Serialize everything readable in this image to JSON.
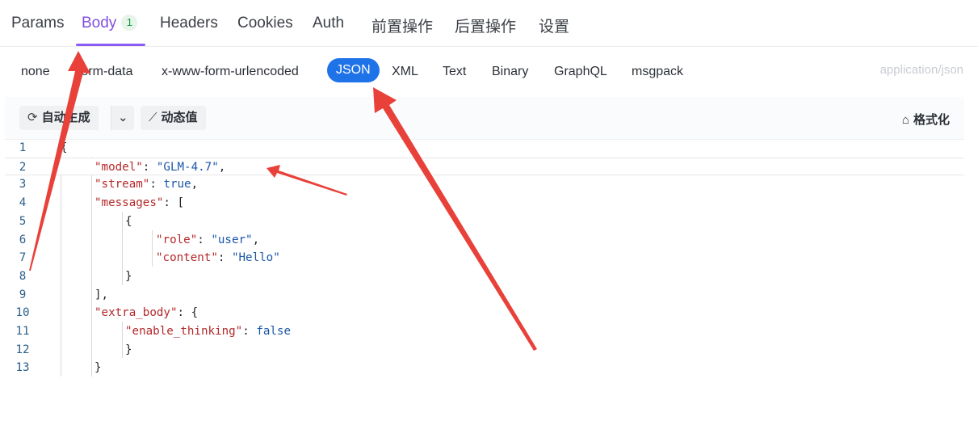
{
  "tabs": [
    {
      "label": "Params"
    },
    {
      "label": "Body",
      "badge": "1",
      "active": true
    },
    {
      "label": "Headers"
    },
    {
      "label": "Cookies"
    },
    {
      "label": "Auth"
    },
    {
      "label": "前置操作"
    },
    {
      "label": "后置操作"
    },
    {
      "label": "设置"
    }
  ],
  "body_types": [
    "none",
    "form-data",
    "x-www-form-urlencoded",
    "JSON",
    "XML",
    "Text",
    "Binary",
    "GraphQL",
    "msgpack"
  ],
  "active_body_type": "JSON",
  "content_type": "application/json",
  "toolbar": {
    "auto_generate": "自动生成",
    "dynamic_value": "动态值",
    "format": "格式化"
  },
  "editor": {
    "lines": [
      {
        "n": "1",
        "indent": 0,
        "parts": [
          [
            "p",
            "{"
          ]
        ]
      },
      {
        "n": "2",
        "indent": 1,
        "parts": [
          [
            "k",
            "\"model\""
          ],
          [
            "p",
            ": "
          ],
          [
            "s",
            "\"GLM-4.7\""
          ],
          [
            "p",
            ","
          ]
        ]
      },
      {
        "n": "3",
        "indent": 1,
        "parts": [
          [
            "k",
            "\"stream\""
          ],
          [
            "p",
            ": "
          ],
          [
            "b",
            "true"
          ],
          [
            "p",
            ","
          ]
        ]
      },
      {
        "n": "4",
        "indent": 1,
        "parts": [
          [
            "k",
            "\"messages\""
          ],
          [
            "p",
            ": ["
          ]
        ]
      },
      {
        "n": "5",
        "indent": 2,
        "parts": [
          [
            "p",
            "{"
          ]
        ]
      },
      {
        "n": "6",
        "indent": 3,
        "parts": [
          [
            "k",
            "\"role\""
          ],
          [
            "p",
            ": "
          ],
          [
            "s",
            "\"user\""
          ],
          [
            "p",
            ","
          ]
        ]
      },
      {
        "n": "7",
        "indent": 3,
        "parts": [
          [
            "k",
            "\"content\""
          ],
          [
            "p",
            ": "
          ],
          [
            "s",
            "\"Hello\""
          ]
        ]
      },
      {
        "n": "8",
        "indent": 2,
        "parts": [
          [
            "p",
            "}"
          ]
        ]
      },
      {
        "n": "9",
        "indent": 1,
        "parts": [
          [
            "p",
            "],"
          ]
        ]
      },
      {
        "n": "10",
        "indent": 1,
        "parts": [
          [
            "k",
            "\"extra_body\""
          ],
          [
            "p",
            ": {"
          ]
        ]
      },
      {
        "n": "11",
        "indent": 2,
        "parts": [
          [
            "k",
            "\"enable_thinking\""
          ],
          [
            "p",
            ": "
          ],
          [
            "b",
            "false"
          ]
        ]
      },
      {
        "n": "12",
        "indent": 2,
        "parts": [
          [
            "p",
            "}"
          ]
        ]
      },
      {
        "n": "13",
        "indent": 1,
        "parts": [
          [
            "p",
            "}"
          ]
        ]
      }
    ]
  },
  "colors": {
    "accent": "#8b5cf6",
    "json_pill": "#1e73e8",
    "annotation": "#e8413a"
  }
}
